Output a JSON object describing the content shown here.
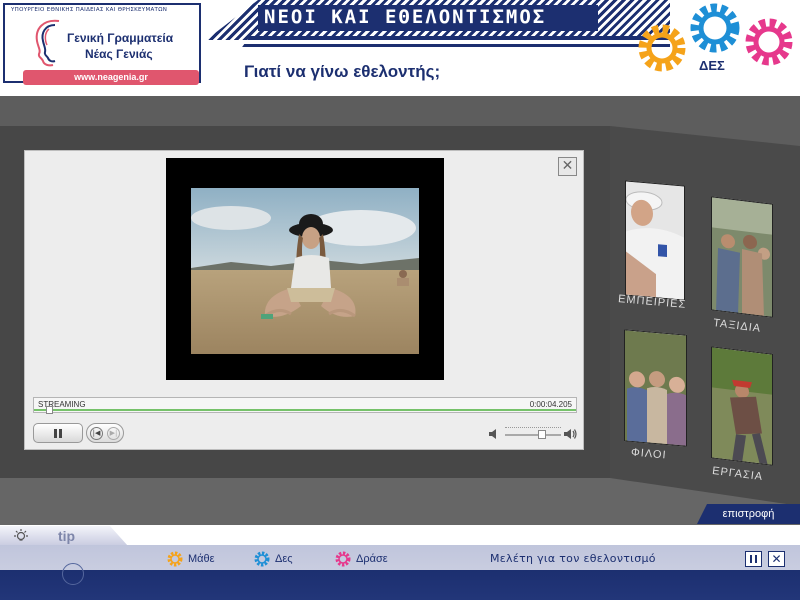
{
  "header": {
    "ministry": "ΥΠΟΥΡΓΕΙΟ ΕΘΝΙΚΗΣ ΠΑΙΔΕΙΑΣ ΚΑΙ ΘΡΗΣΚΕΥΜΑΤΩΝ",
    "org_line1": "Γενική Γραμματεία",
    "org_line2": "Νέας Γενιάς",
    "url": "www.neagenia.gr",
    "banner_title": "ΝΕΟΙ ΚΑΙ ΕΘΕΛΟΝΤΙΣΜΟΣ",
    "page_question": "Γιατί να γίνω εθελοντής;",
    "section_label": "ΔΕΣ"
  },
  "player": {
    "status": "STREAMING",
    "timecode": "0:00:04.205",
    "close_symbol": "✕",
    "prev_symbol": "|◀",
    "next_symbol": "▶|",
    "volume_level": 0.66
  },
  "nav_cards": [
    {
      "label": "ΕΜΠΕΙΡΙΕΣ"
    },
    {
      "label": "ΤΑΞΙΔΙΑ"
    },
    {
      "label": "ΦΙΛΟΙ"
    },
    {
      "label": "ΕΡΓΑΣΙΑ"
    }
  ],
  "return_label": "επιστροφή",
  "footer": {
    "tip": "tip",
    "learn": "Μάθε",
    "see": "Δες",
    "act": "Δράσε",
    "study": "Μελέτη για τον εθελοντισμό",
    "close_symbol": "✕"
  },
  "colors": {
    "navy": "#1c2f70",
    "gear_orange": "#f5a31a",
    "gear_blue": "#1e8fd6",
    "gear_pink": "#e6388c",
    "url_pink": "#e0566e",
    "progress_green": "#76c26a"
  }
}
